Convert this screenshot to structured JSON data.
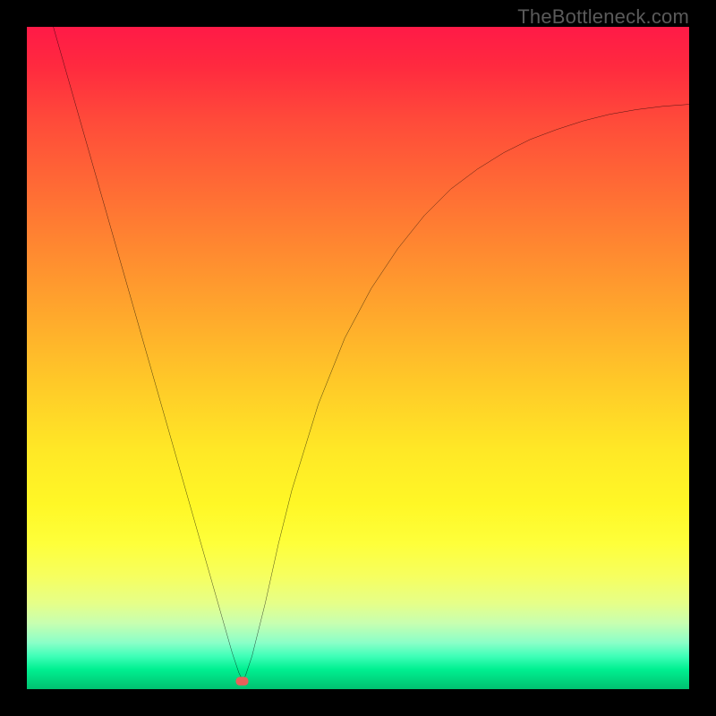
{
  "watermark": "TheBottleneck.com",
  "chart_data": {
    "type": "line",
    "title": "",
    "xlabel": "",
    "ylabel": "",
    "xlim": [
      0,
      100
    ],
    "ylim": [
      0,
      100
    ],
    "grid": false,
    "curve": {
      "name": "bottleneck-curve",
      "color": "#000000",
      "x": [
        4,
        6,
        8,
        10,
        12,
        14,
        16,
        18,
        20,
        22,
        24,
        26,
        28,
        30,
        31,
        32,
        32.5,
        33,
        34,
        36,
        38,
        40,
        44,
        48,
        52,
        56,
        60,
        64,
        68,
        72,
        76,
        80,
        84,
        88,
        92,
        96,
        100
      ],
      "y": [
        100,
        93,
        86,
        79,
        72,
        65,
        58,
        51,
        44,
        37,
        30,
        23,
        16,
        9,
        5.5,
        2.5,
        1.5,
        2,
        5,
        13,
        22,
        30,
        43,
        53,
        60.5,
        66.5,
        71.5,
        75.5,
        78.5,
        81,
        83,
        84.5,
        85.8,
        86.8,
        87.5,
        88,
        88.3
      ]
    },
    "marker": {
      "name": "optimum-marker",
      "shape": "rounded-rect",
      "color": "#e8605a",
      "x": 32.5,
      "y": 1.2,
      "w_pct": 1.9,
      "h_pct": 1.3
    }
  }
}
